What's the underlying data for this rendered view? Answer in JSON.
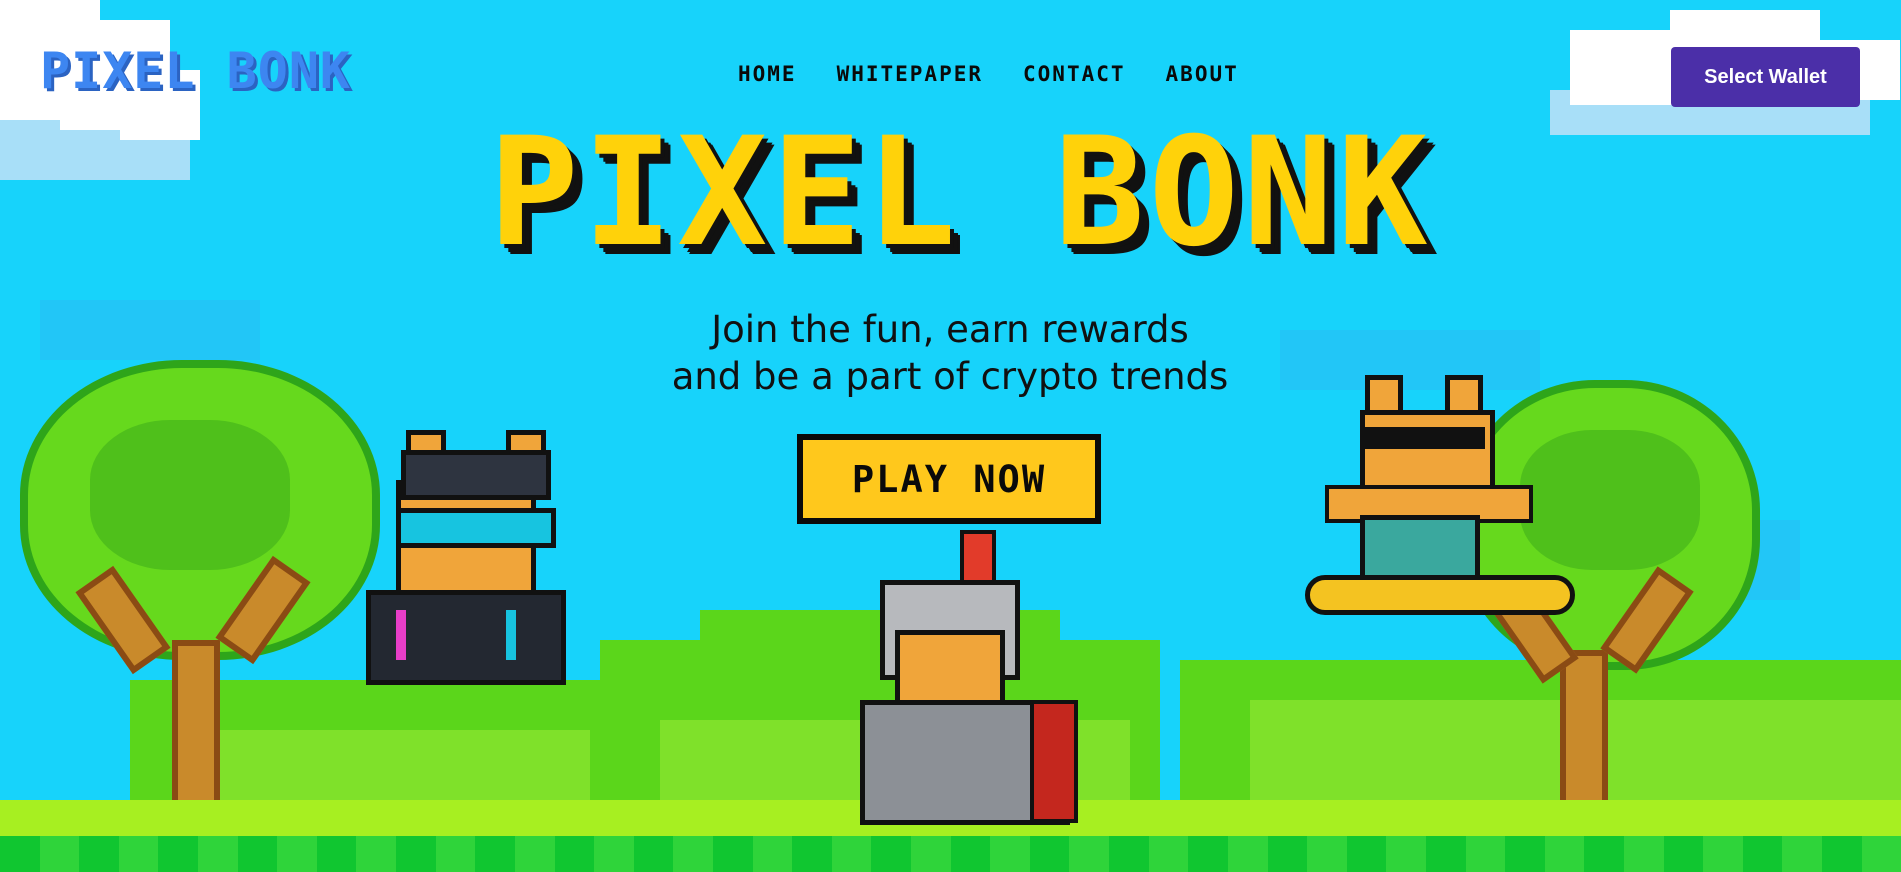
{
  "header": {
    "logo": "PIXEL BONK",
    "nav": [
      "HOME",
      "WHITEPAPER",
      "CONTACT",
      "ABOUT"
    ],
    "wallet_button": "Select Wallet"
  },
  "hero": {
    "title": "PIXEL BONK",
    "tagline_line1": "Join the fun, earn rewards",
    "tagline_line2": "and be a part of crypto trends",
    "cta": "PLAY NOW"
  },
  "colors": {
    "sky": "#17d3fb",
    "title_yellow": "#ffd20a",
    "logo_blue": "#3d86f1",
    "wallet_purple": "#4b2fa8",
    "grass": "#a7ef21"
  },
  "characters": [
    "cyber-dog-icon",
    "knight-dog-icon",
    "surfer-dog-icon"
  ]
}
